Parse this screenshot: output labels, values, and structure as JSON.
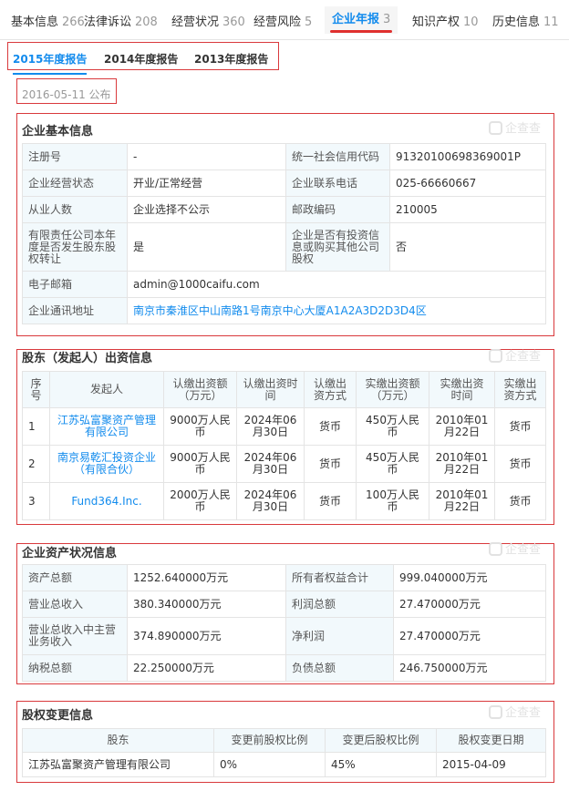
{
  "tabs": [
    {
      "label": "基本信息",
      "count": "266"
    },
    {
      "label": "法律诉讼",
      "count": "208"
    },
    {
      "label": "经营状况",
      "count": "360"
    },
    {
      "label": "经营风险",
      "count": "5"
    },
    {
      "label": "企业年报",
      "count": "3"
    },
    {
      "label": "知识产权",
      "count": "10"
    },
    {
      "label": "历史信息",
      "count": "11"
    }
  ],
  "year_tabs": [
    "2015年度报告",
    "2014年度报告",
    "2013年度报告"
  ],
  "publish_date": "2016-05-11 公布",
  "watermark": "企查查",
  "basic": {
    "title": "企业基本信息",
    "rows": [
      {
        "l1": "注册号",
        "v1": "-",
        "l2": "统一社会信用代码",
        "v2": "91320100698369001P"
      },
      {
        "l1": "企业经营状态",
        "v1": "开业/正常经营",
        "l2": "企业联系电话",
        "v2": "025-66660667"
      },
      {
        "l1": "从业人数",
        "v1": "企业选择不公示",
        "l2": "邮政编码",
        "v2": "210005"
      },
      {
        "l1": "有限责任公司本年度是否发生股东股权转让",
        "v1": "是",
        "l2": "企业是否有投资信息或购买其他公司股权",
        "v2": "否"
      }
    ],
    "email_label": "电子邮箱",
    "email": "admin@1000caifu.com",
    "address_label": "企业通讯地址",
    "address": "南京市秦淮区中山南路1号南京中心大厦A1A2A3D2D3D4区"
  },
  "shareholders": {
    "title": "股东（发起人）出资信息",
    "headers": [
      "序号",
      "发起人",
      "认缴出资额（万元）",
      "认缴出资时间",
      "认缴出资方式",
      "实缴出资额（万元）",
      "实缴出资时间",
      "实缴出资方式"
    ],
    "rows": [
      {
        "no": "1",
        "name": "江苏弘富聚资产管理有限公司",
        "sub_amt": "9000万人民币",
        "sub_date": "2024年06月30日",
        "sub_way": "货币",
        "paid_amt": "450万人民币",
        "paid_date": "2010年01月22日",
        "paid_way": "货币"
      },
      {
        "no": "2",
        "name": "南京易乾汇投资企业（有限合伙）",
        "sub_amt": "9000万人民币",
        "sub_date": "2024年06月30日",
        "sub_way": "货币",
        "paid_amt": "450万人民币",
        "paid_date": "2010年01月22日",
        "paid_way": "货币"
      },
      {
        "no": "3",
        "name": "Fund364.Inc.",
        "sub_amt": "2000万人民币",
        "sub_date": "2024年06月30日",
        "sub_way": "货币",
        "paid_amt": "100万人民币",
        "paid_date": "2010年01月22日",
        "paid_way": "货币"
      }
    ]
  },
  "assets": {
    "title": "企业资产状况信息",
    "rows": [
      {
        "l1": "资产总额",
        "v1": "1252.640000万元",
        "l2": "所有者权益合计",
        "v2": "999.040000万元"
      },
      {
        "l1": "营业总收入",
        "v1": "380.340000万元",
        "l2": "利润总额",
        "v2": "27.470000万元"
      },
      {
        "l1": "营业总收入中主营业务收入",
        "v1": "374.890000万元",
        "l2": "净利润",
        "v2": "27.470000万元"
      },
      {
        "l1": "纳税总额",
        "v1": "22.250000万元",
        "l2": "负债总额",
        "v2": "246.750000万元"
      }
    ]
  },
  "equity": {
    "title": "股权变更信息",
    "headers": [
      "股东",
      "变更前股权比例",
      "变更后股权比例",
      "股权变更日期"
    ],
    "rows": [
      {
        "holder": "江苏弘富聚资产管理有限公司",
        "before": "0%",
        "after": "45%",
        "date": "2015-04-09"
      }
    ]
  },
  "colors": {
    "accent": "#128bed",
    "highlight_box": "#d9393c",
    "label_bg": "#f2f9fc"
  }
}
